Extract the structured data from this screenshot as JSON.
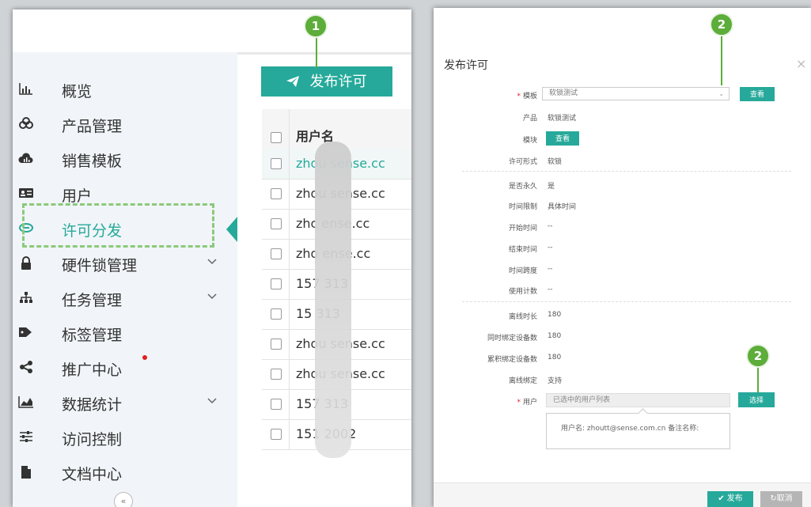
{
  "annotations": {
    "badge_1": "1",
    "badge_2": "2"
  },
  "sidebar": {
    "items": [
      {
        "icon": "bar-chart-icon",
        "label": "概览"
      },
      {
        "icon": "cubes-icon",
        "label": "产品管理"
      },
      {
        "icon": "cloud-chart-icon",
        "label": "销售模板"
      },
      {
        "icon": "id-card-icon",
        "label": "用户"
      },
      {
        "icon": "link-icon",
        "label": "许可分发"
      },
      {
        "icon": "lock-icon",
        "label": "硬件锁管理"
      },
      {
        "icon": "sitemap-icon",
        "label": "任务管理"
      },
      {
        "icon": "tags-icon",
        "label": "标签管理"
      },
      {
        "icon": "share-icon",
        "label": "推广中心"
      },
      {
        "icon": "area-chart-icon",
        "label": "数据统计"
      },
      {
        "icon": "sliders-icon",
        "label": "访问控制"
      },
      {
        "icon": "file-icon",
        "label": "文档中心"
      }
    ],
    "active_label": "许可分发",
    "collapse_glyph": "«"
  },
  "toolbar": {
    "publish_label": "发布许可"
  },
  "table": {
    "header": "用户名",
    "rows": [
      "zhou sense.cc",
      "zhou sense.cc",
      "zhc ense.cc",
      "zho ense.cc",
      "157 313",
      "15 313",
      "zhou sense.cc",
      "zhou sense.cc",
      "157 313",
      "151 2002"
    ]
  },
  "dialog": {
    "title": "发布许可",
    "close_glyph": "×",
    "template_label": "模板",
    "template_value": "软锁测试",
    "view_label": "查看",
    "product_label": "产品",
    "product_value": "软锁测试",
    "module_label": "模块",
    "module_view_label": "查看",
    "license_form_label": "许可形式",
    "license_form_value": "软锁",
    "fields": [
      {
        "label": "是否永久",
        "value": "是"
      },
      {
        "label": "时间限制",
        "value": "具体时间"
      },
      {
        "label": "开始时间",
        "value": "--"
      },
      {
        "label": "结束时间",
        "value": "--"
      },
      {
        "label": "时间跨度",
        "value": "--"
      },
      {
        "label": "使用计数",
        "value": "--"
      }
    ],
    "fields2": [
      {
        "label": "离线时长",
        "value": "180"
      },
      {
        "label": "同时绑定设备数",
        "value": "180"
      },
      {
        "label": "累积绑定设备数",
        "value": "180"
      },
      {
        "label": "离线绑定",
        "value": "支持"
      }
    ],
    "user_label": "用户",
    "user_placeholder": "已选中的用户列表",
    "select_label": "选择",
    "tooltip_text": "用户名: zhoutt@sense.com.cn 备注名称:",
    "publish_label": "✔ 发布",
    "cancel_label": "↻取消"
  },
  "colors": {
    "accent": "#26a99a",
    "badge": "#5cad39",
    "dash": "#8cc97a"
  }
}
